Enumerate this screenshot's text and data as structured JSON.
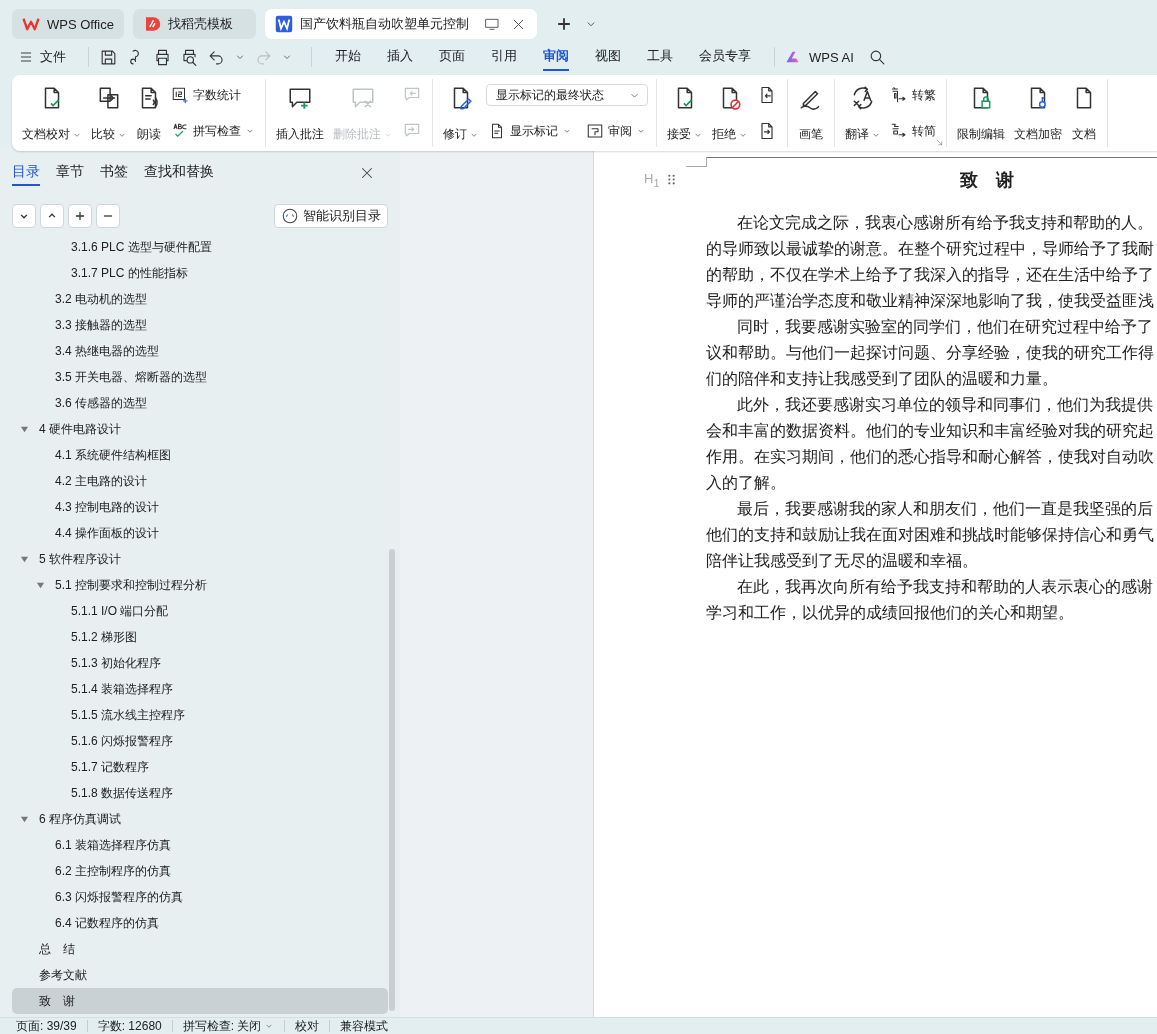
{
  "tabs": [
    {
      "kind": "home",
      "label": "WPS Office",
      "selected": false
    },
    {
      "kind": "template",
      "label": "找稻壳模板",
      "selected": false
    },
    {
      "kind": "document",
      "label": "国产饮料瓶自动吹塑单元控制",
      "selected": true
    }
  ],
  "menu": {
    "file": "文件",
    "tabs": [
      {
        "label": "开始",
        "selected": false
      },
      {
        "label": "插入",
        "selected": false
      },
      {
        "label": "页面",
        "selected": false
      },
      {
        "label": "引用",
        "selected": false
      },
      {
        "label": "审阅",
        "selected": true
      },
      {
        "label": "视图",
        "selected": false
      },
      {
        "label": "工具",
        "selected": false
      },
      {
        "label": "会员专享",
        "selected": false
      }
    ],
    "ai": "WPS AI"
  },
  "ribbon": [
    {
      "launcher": false,
      "items": [
        {
          "kind": "large",
          "label": "文档校对",
          "dropdown": true,
          "disabled": false
        },
        {
          "kind": "large",
          "label": "比较",
          "dropdown": true,
          "disabled": false
        },
        {
          "kind": "large",
          "label": "朗读",
          "dropdown": false,
          "disabled": false
        },
        {
          "kind": "stack",
          "rows": [
            {
              "kind": "small",
              "label": "字数统计",
              "dropdown": false,
              "disabled": false
            },
            {
              "kind": "small",
              "label": "拼写检查",
              "dropdown": true,
              "disabled": false
            }
          ]
        }
      ]
    },
    {
      "launcher": false,
      "items": [
        {
          "kind": "large",
          "label": "插入批注",
          "dropdown": false,
          "disabled": false
        },
        {
          "kind": "large",
          "label": "删除批注",
          "dropdown": true,
          "disabled": true
        },
        {
          "kind": "stack",
          "rows": [
            {
              "kind": "icon",
              "disabled": true
            },
            {
              "kind": "icon",
              "disabled": true
            }
          ]
        }
      ]
    },
    {
      "launcher": false,
      "items": [
        {
          "kind": "large",
          "label": "修订",
          "dropdown": true,
          "disabled": false
        },
        {
          "kind": "stack",
          "rows": [
            {
              "kind": "select",
              "value": "显示标记的最终状态"
            },
            {
              "kind": "pair",
              "items": [
                {
                  "kind": "small",
                  "label": "显示标记",
                  "dropdown": true,
                  "disabled": false
                },
                {
                  "kind": "small",
                  "label": "审阅",
                  "dropdown": true,
                  "disabled": false
                }
              ]
            }
          ]
        }
      ]
    },
    {
      "launcher": false,
      "items": [
        {
          "kind": "large",
          "label": "接受",
          "dropdown": true,
          "disabled": false
        },
        {
          "kind": "large",
          "label": "拒绝",
          "dropdown": true,
          "disabled": false
        },
        {
          "kind": "stack",
          "rows": [
            {
              "kind": "icon",
              "disabled": false
            },
            {
              "kind": "icon",
              "disabled": false
            }
          ]
        }
      ]
    },
    {
      "launcher": false,
      "items": [
        {
          "kind": "large",
          "label": "画笔",
          "dropdown": false,
          "disabled": false
        }
      ]
    },
    {
      "launcher": true,
      "items": [
        {
          "kind": "large",
          "label": "翻译",
          "dropdown": true,
          "disabled": false
        },
        {
          "kind": "stack",
          "rows": [
            {
              "kind": "small",
              "label": "转繁",
              "dropdown": false,
              "disabled": false
            },
            {
              "kind": "small",
              "label": "转简",
              "dropdown": false,
              "disabled": false
            }
          ]
        }
      ]
    },
    {
      "launcher": false,
      "items": [
        {
          "kind": "large",
          "label": "限制编辑",
          "dropdown": false,
          "disabled": false
        },
        {
          "kind": "large",
          "label": "文档加密",
          "dropdown": false,
          "disabled": false
        },
        {
          "kind": "large",
          "label": "文档",
          "dropdown": false,
          "disabled": false
        }
      ]
    }
  ],
  "sidebar": {
    "tabs": [
      {
        "label": "目录",
        "selected": true
      },
      {
        "label": "章节",
        "selected": false
      },
      {
        "label": "书签",
        "selected": false
      },
      {
        "label": "查找和替换",
        "selected": false
      }
    ],
    "smart_button": "智能识别目录",
    "toc": [
      {
        "children": [
          {
            "children": [
              {
                "label": "3.1.6 PLC 选型与硬件配置",
                "selected": false
              },
              {
                "label": "3.1.7 PLC 的性能指标",
                "selected": false
              }
            ]
          },
          {
            "label": "3.2 电动机的选型",
            "selected": false
          },
          {
            "label": "3.3 接触器的选型",
            "selected": false
          },
          {
            "label": "3.4 热继电器的选型",
            "selected": false
          },
          {
            "label": "3.5 开关电器、熔断器的选型",
            "selected": false
          },
          {
            "label": "3.6 传感器的选型",
            "selected": false
          }
        ]
      },
      {
        "label": "4  硬件电路设计",
        "expanded": true,
        "selected": false,
        "children": [
          {
            "label": "4.1 系统硬件结构框图",
            "selected": false
          },
          {
            "label": "4.2 主电路的设计",
            "selected": false
          },
          {
            "label": "4.3 控制电路的设计",
            "selected": false
          },
          {
            "label": "4.4 操作面板的设计",
            "selected": false
          }
        ]
      },
      {
        "label": "5  软件程序设计",
        "expanded": true,
        "selected": false,
        "children": [
          {
            "label": "5.1 控制要求和控制过程分析",
            "expanded": true,
            "selected": false,
            "children": [
              {
                "label": "5.1.1 I/O 端口分配",
                "selected": false
              },
              {
                "label": "5.1.2 梯形图",
                "selected": false
              },
              {
                "label": "5.1.3 初始化程序",
                "selected": false
              },
              {
                "label": "5.1.4 装箱选择程序",
                "selected": false
              },
              {
                "label": "5.1.5 流水线主控程序",
                "selected": false
              },
              {
                "label": "5.1.6 闪烁报警程序",
                "selected": false
              },
              {
                "label": "5.1.7 记数程序",
                "selected": false
              },
              {
                "label": "5.1.8 数据传送程序",
                "selected": false
              }
            ]
          }
        ]
      },
      {
        "label": "6  程序仿真调试",
        "expanded": true,
        "selected": false,
        "children": [
          {
            "label": "6.1 装箱选择程序仿真",
            "selected": false
          },
          {
            "label": "6.2 主控制程序的仿真",
            "selected": false
          },
          {
            "label": "6.3 闪烁报警程序的仿真",
            "selected": false
          },
          {
            "label": "6.4 记数程序的仿真",
            "selected": false
          }
        ]
      },
      {
        "label": "总　结",
        "selected": false
      },
      {
        "label": "参考文献",
        "selected": false
      },
      {
        "label": "致　谢",
        "selected": true
      }
    ]
  },
  "document": {
    "heading_tag": "H$_{1}$",
    "title": "致　谢",
    "paragraphs": [
      {
        "lines": [
          "在论文完成之际，我衷心感谢所有给予我支持和帮助的人。",
          "的导师致以最诚挚的谢意。在整个研究过程中，导师给予了我耐",
          "的帮助，不仅在学术上给予了我深入的指导，还在生活中给予了",
          "导师的严谨治学态度和敬业精神深深地影响了我，使我受益匪浅"
        ]
      },
      {
        "lines": [
          "同时，我要感谢实验室的同学们，他们在研究过程中给予了",
          "议和帮助。与他们一起探讨问题、分享经验，使我的研究工作得",
          "们的陪伴和支持让我感受到了团队的温暖和力量。"
        ]
      },
      {
        "lines": [
          "此外，我还要感谢实习单位的领导和同事们，他们为我提供",
          "会和丰富的数据资料。他们的专业知识和丰富经验对我的研究起",
          "作用。在实习期间，他们的悉心指导和耐心解答，使我对自动吹",
          "入的了解。"
        ]
      },
      {
        "lines": [
          "最后，我要感谢我的家人和朋友们，他们一直是我坚强的后",
          "他们的支持和鼓励让我在面对困难和挑战时能够保持信心和勇气",
          "陪伴让我感受到了无尽的温暖和幸福。"
        ]
      },
      {
        "lines": [
          "在此，我再次向所有给予我支持和帮助的人表示衷心的感谢",
          "学习和工作，以优异的成绩回报他们的关心和期望。"
        ]
      }
    ]
  },
  "status_bar": [
    {
      "kind": "text",
      "label": "页面: 39/39"
    },
    {
      "kind": "text",
      "label": "字数: 12680"
    },
    {
      "kind": "dropdown",
      "label": "拼写检查: 关闭"
    },
    {
      "kind": "text",
      "label": "校对"
    },
    {
      "kind": "text",
      "label": "兼容模式"
    }
  ]
}
